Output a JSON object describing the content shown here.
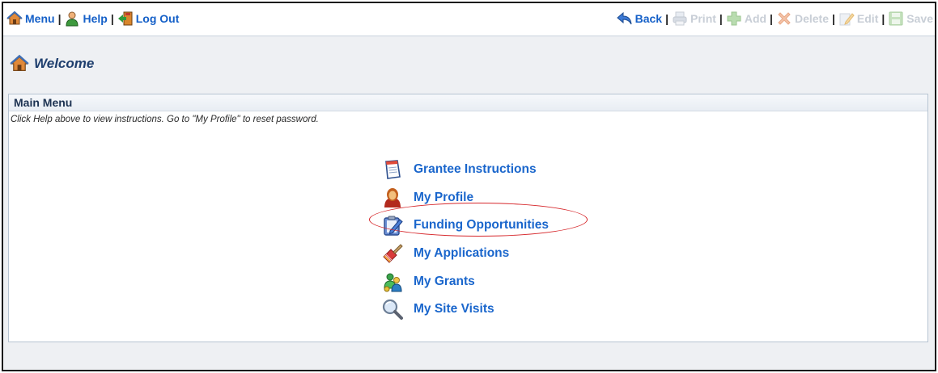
{
  "toolbar": {
    "left": [
      {
        "label": "Menu",
        "icon": "home-icon"
      },
      {
        "label": "Help",
        "icon": "help-person-icon"
      },
      {
        "label": "Log Out",
        "icon": "exit-door-icon"
      }
    ],
    "right": [
      {
        "label": "Back",
        "icon": "back-arrow-icon",
        "enabled": true
      },
      {
        "label": "Print",
        "icon": "print-icon",
        "enabled": false
      },
      {
        "label": "Add",
        "icon": "add-plus-icon",
        "enabled": false
      },
      {
        "label": "Delete",
        "icon": "delete-x-icon",
        "enabled": false
      },
      {
        "label": "Edit",
        "icon": "edit-pencil-icon",
        "enabled": false
      },
      {
        "label": "Save",
        "icon": "save-disk-icon",
        "enabled": false
      }
    ],
    "separator": "|"
  },
  "welcome": {
    "title": "Welcome",
    "icon": "home-icon"
  },
  "main_menu": {
    "title": "Main Menu",
    "note": "Click Help above to view instructions. Go to \"My Profile\" to reset password.",
    "items": [
      {
        "label": "Grantee Instructions",
        "icon": "notepad-icon"
      },
      {
        "label": "My Profile",
        "icon": "person-icon"
      },
      {
        "label": "Funding Opportunities",
        "icon": "clipboard-pencil-icon",
        "highlighted": true
      },
      {
        "label": "My Applications",
        "icon": "paint-brush-icon"
      },
      {
        "label": "My Grants",
        "icon": "people-money-icon"
      },
      {
        "label": "My Site Visits",
        "icon": "magnifier-icon"
      }
    ]
  },
  "colors": {
    "link": "#1a66cc",
    "disabled": "#c8ced6",
    "highlight_ring": "#d6262a",
    "heading": "#1f3f6e"
  }
}
